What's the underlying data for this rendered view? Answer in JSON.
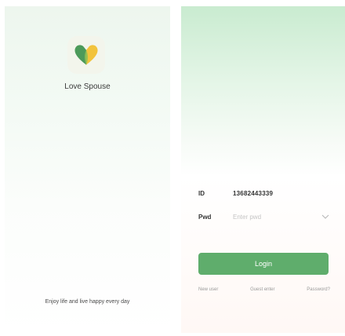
{
  "splash": {
    "app_name": "Love Spouse",
    "slogan": "Enjoy life and live happy every day",
    "logo_icon": "heart-logo-icon"
  },
  "login": {
    "id_label": "ID",
    "id_value": "13682443339",
    "password_label": "Pwd",
    "password_placeholder": "Enter pwd",
    "eye_icon": "eye-toggle-icon",
    "login_button": "Login",
    "links": {
      "new_user": "New user",
      "guest": "Guest enter",
      "forgot": "Password?"
    }
  },
  "colors": {
    "accent": "#5fad6c",
    "heart_green": "#4c9a5a",
    "heart_yellow": "#f2c33c"
  }
}
